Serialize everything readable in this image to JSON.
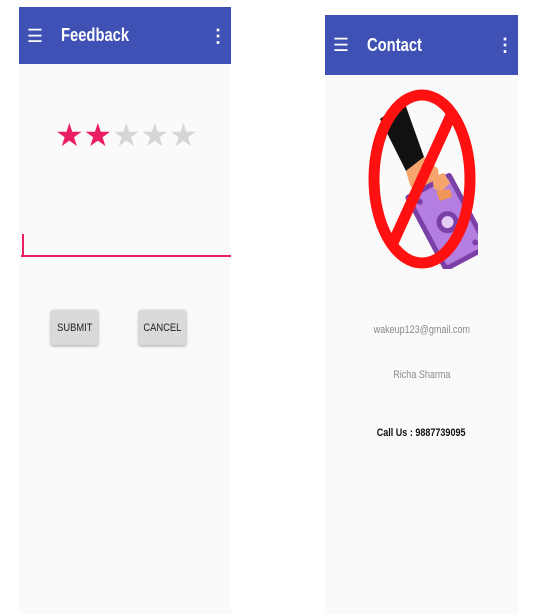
{
  "feedback_screen": {
    "title": "Feedback",
    "menu_glyph": "☰",
    "more_glyph": "⋮",
    "rating": {
      "value": 2,
      "max": 5,
      "filled_color": "#e91e63",
      "empty_color": "#d6d6d6"
    },
    "comment": {
      "value": ""
    },
    "submit_label": "SUBMIT",
    "cancel_label": "CANCEL"
  },
  "contact_screen": {
    "title": "Contact",
    "menu_glyph": "☰",
    "more_glyph": "⋮",
    "image": "no-bribery-icon",
    "email": "wakeup123@gmail.com",
    "name": "Richa Sharma",
    "phone": "Call Us : 9887739095"
  },
  "colors": {
    "appbar": "#3f51b5",
    "accent": "#e91e63",
    "background": "#fafafa"
  }
}
